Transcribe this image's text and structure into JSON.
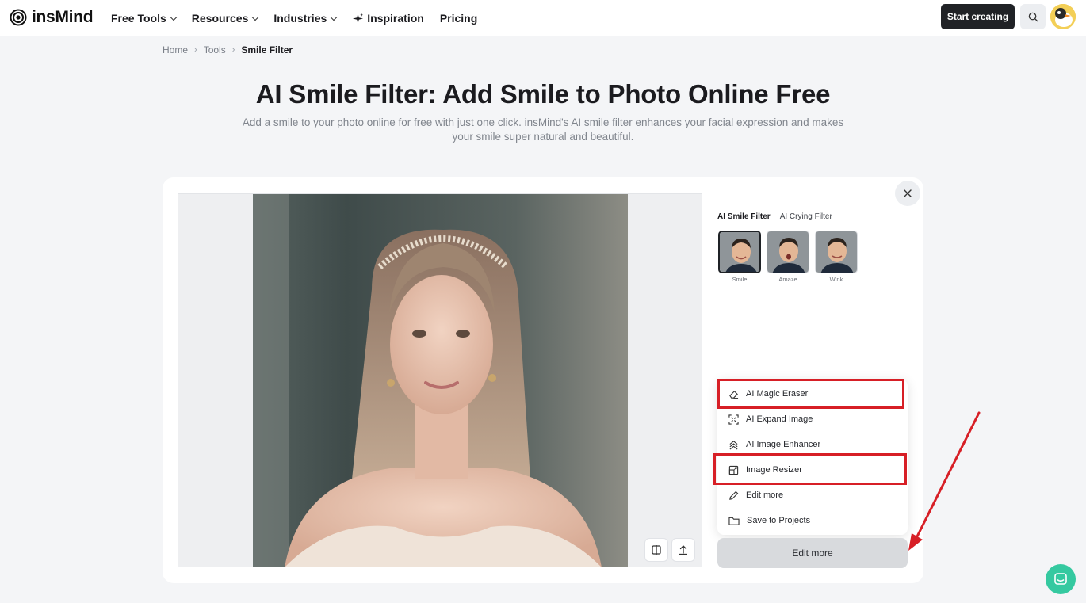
{
  "header": {
    "logo_text": "insMind",
    "nav": [
      {
        "label": "Free Tools",
        "has_dropdown": true
      },
      {
        "label": "Resources",
        "has_dropdown": true
      },
      {
        "label": "Industries",
        "has_dropdown": true
      },
      {
        "label": "Inspiration",
        "icon": "sparkle-icon"
      },
      {
        "label": "Pricing"
      }
    ],
    "start_button": "Start creating",
    "search_icon": "search-icon",
    "avatar_icon": "duck-avatar"
  },
  "breadcrumb": {
    "items": [
      "Home",
      "Tools"
    ],
    "current": "Smile Filter",
    "separator": "›"
  },
  "page": {
    "title": "AI Smile Filter: Add Smile to Photo Online Free",
    "subtitle": "Add a smile to your photo online for free with just one click. insMind's AI smile filter enhances your facial expression and makes your smile super natural and beautiful."
  },
  "editor": {
    "tabs": [
      {
        "label": "AI Smile Filter",
        "active": true
      },
      {
        "label": "AI Crying Filter",
        "active": false
      }
    ],
    "presets": [
      {
        "label": "Smile",
        "selected": true
      },
      {
        "label": "Amaze",
        "selected": false
      },
      {
        "label": "Wink",
        "selected": false
      }
    ],
    "menu": [
      {
        "label": "AI Magic Eraser",
        "icon": "eraser-icon",
        "highlighted": true
      },
      {
        "label": "AI Expand Image",
        "icon": "expand-icon",
        "highlighted": false
      },
      {
        "label": "AI Image Enhancer",
        "icon": "enhancer-icon",
        "highlighted": false
      },
      {
        "label": "Image Resizer",
        "icon": "resize-icon",
        "highlighted": true
      },
      {
        "label": "Edit more",
        "icon": "pencil-icon",
        "highlighted": false
      },
      {
        "label": "Save to Projects",
        "icon": "folder-icon",
        "highlighted": false
      }
    ],
    "edit_more_button": "Edit more",
    "canvas_tools": [
      "compare-icon",
      "upload-icon"
    ],
    "close_icon": "close-icon"
  },
  "annotation": {
    "highlight_color": "#d71f26"
  },
  "chat_icon": "chat-icon"
}
